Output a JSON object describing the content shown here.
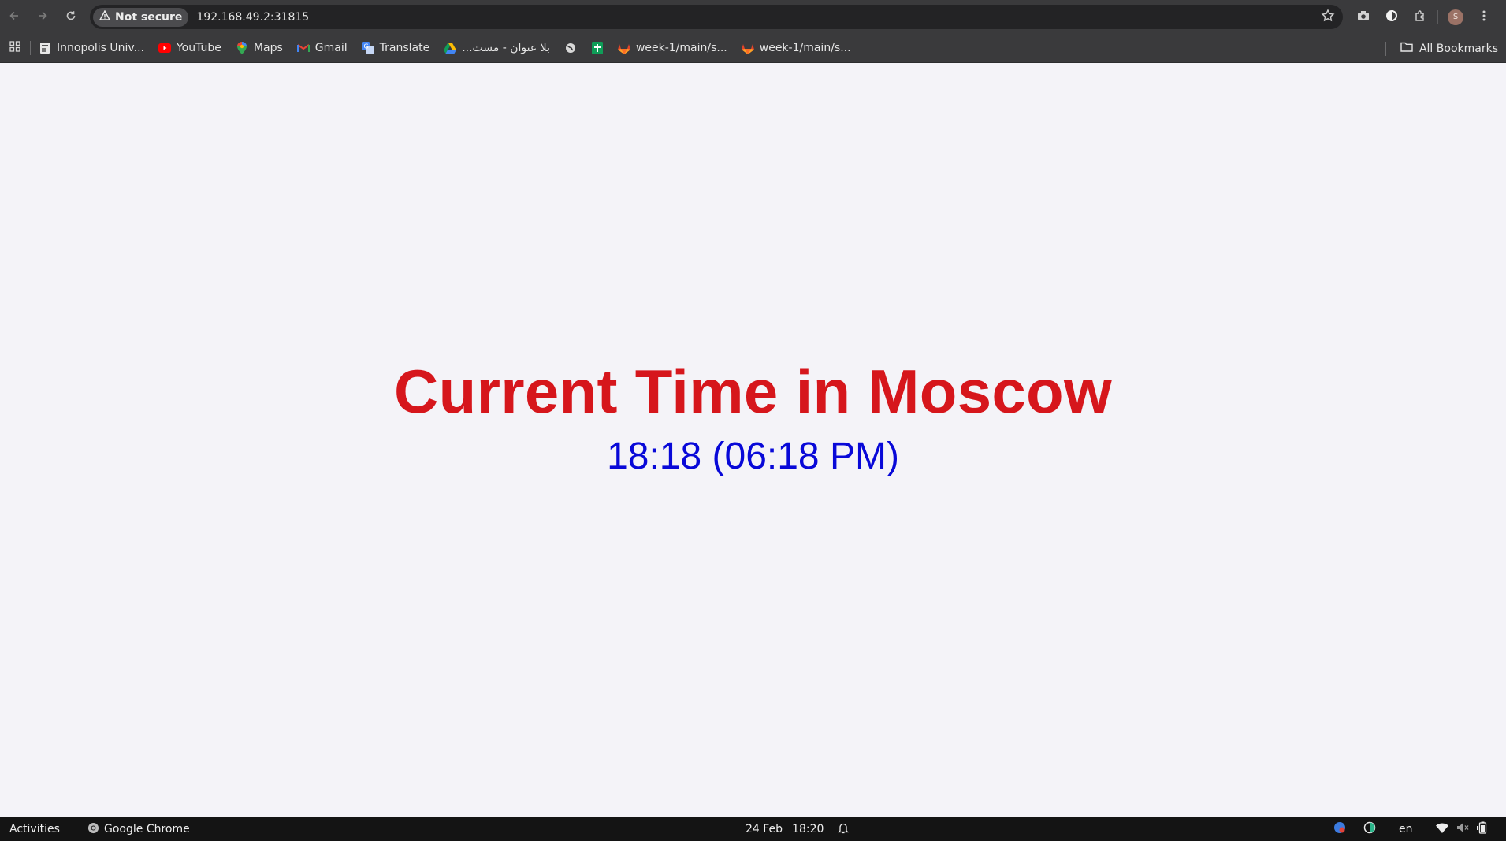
{
  "browser": {
    "nav": {
      "back_icon": "arrow-left-icon",
      "forward_icon": "arrow-right-icon",
      "reload_icon": "reload-icon"
    },
    "omnibox": {
      "security_label": "Not secure",
      "url": "192.168.49.2:31815"
    },
    "bookmarks": [
      {
        "label": "Innopolis Univ...",
        "icon": "document-icon"
      },
      {
        "label": "YouTube",
        "icon": "youtube-icon"
      },
      {
        "label": "Maps",
        "icon": "maps-pin-icon"
      },
      {
        "label": "Gmail",
        "icon": "gmail-icon"
      },
      {
        "label": "Translate",
        "icon": "translate-icon"
      },
      {
        "label": "بلا عنوان - مست...",
        "icon": "drive-icon"
      },
      {
        "label": "",
        "icon": "globe-icon"
      },
      {
        "label": "",
        "icon": "sheets-plus-icon"
      },
      {
        "label": "week-1/main/s...",
        "icon": "gitlab-icon"
      },
      {
        "label": "week-1/main/s...",
        "icon": "gitlab-icon"
      }
    ],
    "all_bookmarks_label": "All Bookmarks",
    "profile_initial": "S"
  },
  "page": {
    "title": "Current Time in Moscow",
    "time": "18:18 (06:18 PM)"
  },
  "colors": {
    "title": "#d6161c",
    "time": "#0808d8",
    "page_bg": "#f4f3f8",
    "chrome_bg": "#3a3a3c"
  },
  "taskbar": {
    "activities": "Activities",
    "app_name": "Google Chrome",
    "date": "24 Feb",
    "clock": "18:20",
    "language": "en"
  }
}
